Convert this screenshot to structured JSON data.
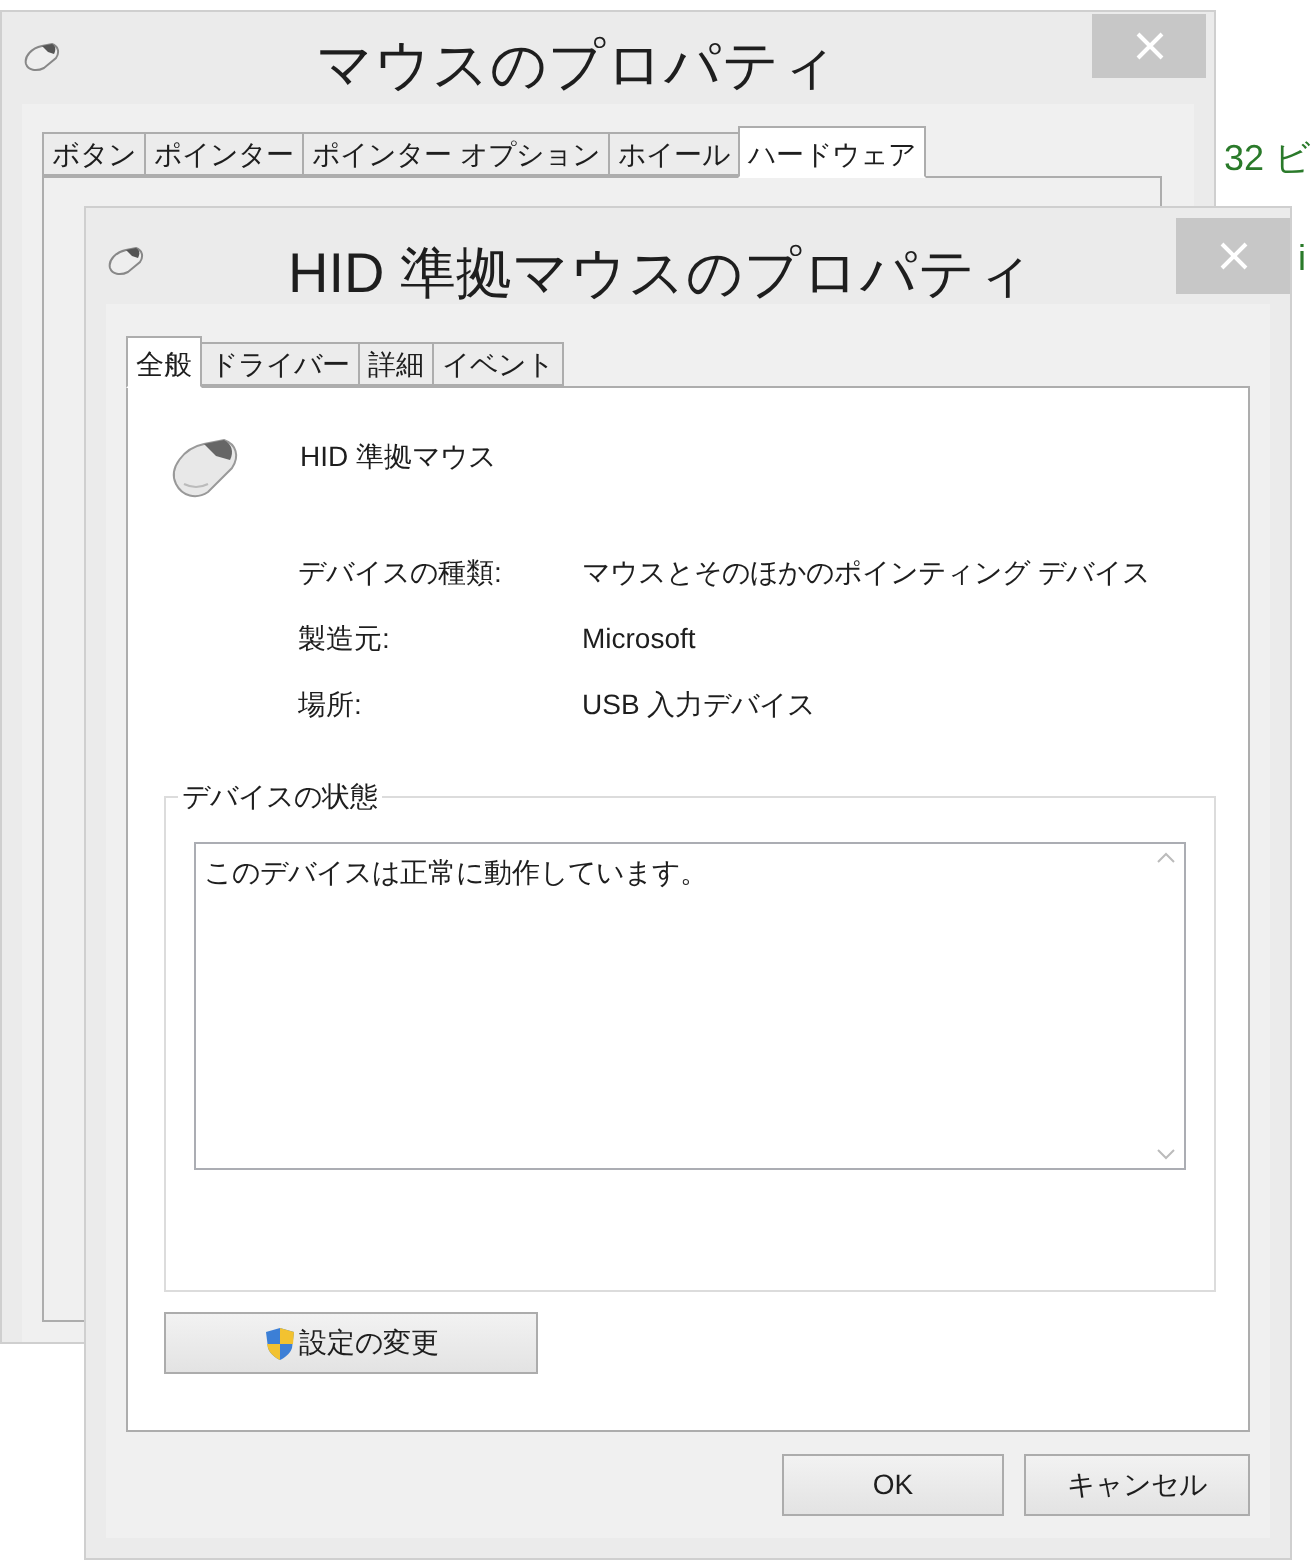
{
  "back_window": {
    "title": "マウスのプロパティ",
    "tabs": [
      {
        "label": "ボタン",
        "selected": false
      },
      {
        "label": "ポインター",
        "selected": false
      },
      {
        "label": "ポインター オプション",
        "selected": false
      },
      {
        "label": "ホイール",
        "selected": false
      },
      {
        "label": "ハードウェア",
        "selected": true
      }
    ]
  },
  "background_text": [
    "32 ビ",
    "i"
  ],
  "window": {
    "title": "HID 準拠マウスのプロパティ",
    "tabs": [
      {
        "label": "全般",
        "selected": true
      },
      {
        "label": "ドライバー",
        "selected": false
      },
      {
        "label": "詳細",
        "selected": false
      },
      {
        "label": "イベント",
        "selected": false
      }
    ],
    "device_name": "HID 準拠マウス",
    "properties": [
      {
        "label": "デバイスの種類:",
        "value": "マウスとそのほかのポインティング デバイス"
      },
      {
        "label": "製造元:",
        "value": "Microsoft"
      },
      {
        "label": "場所:",
        "value": "USB 入力デバイス"
      }
    ],
    "status_group": {
      "title": "デバイスの状態",
      "text": "このデバイスは正常に動作しています。"
    },
    "change_settings_button": "設定の変更",
    "buttons": [
      "OK",
      "キャンセル"
    ]
  }
}
